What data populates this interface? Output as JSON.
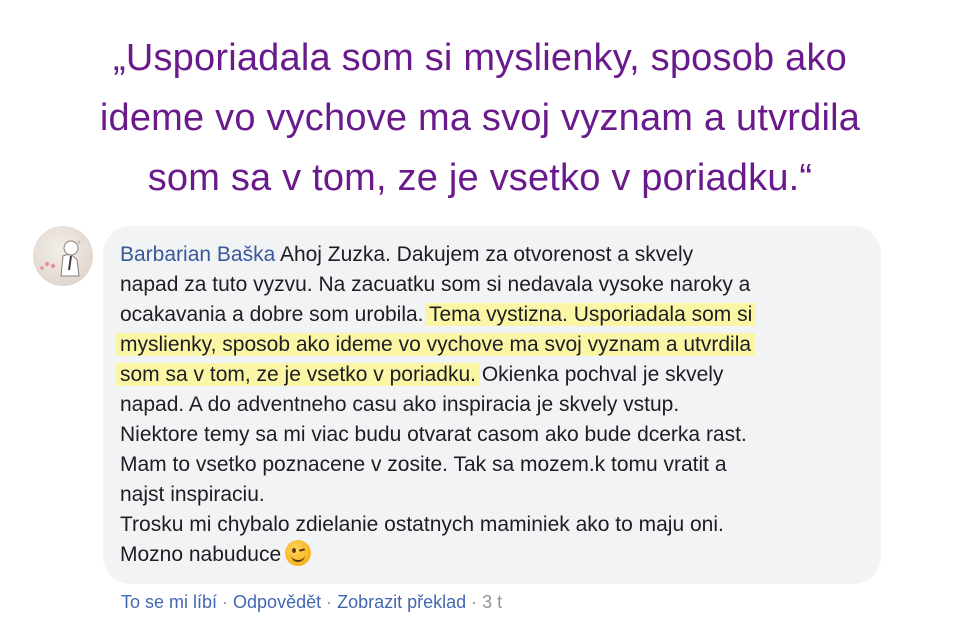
{
  "quote": {
    "lines": [
      "„Usporiadala som si myslienky, sposob ako",
      "ideme vo vychove ma svoj vyznam a utvrdila",
      "som sa v tom, ze je vsetko v poriadku.“"
    ]
  },
  "comment": {
    "author": "Barbarian Baška",
    "lines": [
      " Ahoj Zuzka. Dakujem za otvorenost a skvely",
      "napad za tuto vyzvu. Na zacuatku som si nedavala vysoke naroky a",
      "ocakavania a dobre som urobila.",
      "Tema vystizna. Usporiadala som si",
      "myslienky, sposob ako ideme vo vychove ma svoj vyznam a utvrdila",
      "som sa v tom, ze je vsetko v poriadku.",
      " Okienka pochval je skvely",
      "napad. A do adventneho casu ako inspiracia je skvely vstup.",
      "Niektore temy sa mi viac budu otvarat casom ako bude dcerka rast.",
      "Mam to vsetko poznacene v zosite. Tak sa mozem.k tomu vratit a",
      "najst inspiraciu.",
      "Trosku mi chybalo zdielanie ostatnych maminiek ako to maju oni.",
      "Mozno nabuduce"
    ],
    "emoji": "wink-emoji"
  },
  "actions": {
    "like": "To se mi líbí",
    "reply": "Odpovědět",
    "translate": "Zobrazit překlad",
    "separator": "·",
    "time": "3 t"
  },
  "colors": {
    "quote": "#6b1a8c",
    "author": "#385898",
    "highlight": "#fbf5a6",
    "bubble": "#f2f3f5",
    "link": "#4267b2"
  }
}
